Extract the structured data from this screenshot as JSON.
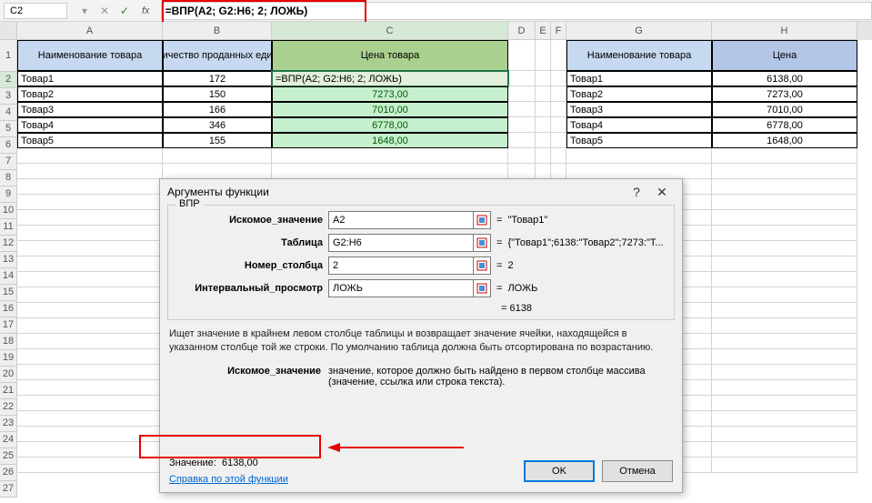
{
  "formula_bar": {
    "cell_ref": "C2",
    "formula": "=ВПР(A2; G2:H6; 2; ЛОЖЬ)"
  },
  "columns": [
    "A",
    "B",
    "C",
    "D",
    "E",
    "F",
    "G",
    "H"
  ],
  "row_numbers": [
    1,
    2,
    3,
    4,
    5,
    6,
    7,
    8,
    9,
    10,
    11,
    12,
    13,
    14,
    15,
    16,
    17,
    18,
    19,
    20,
    21,
    22,
    23,
    24,
    25,
    26,
    27
  ],
  "headers": {
    "A": "Наименование товара",
    "B": "Количество проданных единиц",
    "C": "Цена товара",
    "G": "Наименование товара",
    "H": "Цена"
  },
  "table1": [
    {
      "name": "Товар1",
      "qty": "172",
      "price": "=ВПР(A2; G2:H6; 2; ЛОЖЬ)"
    },
    {
      "name": "Товар2",
      "qty": "150",
      "price": "7273,00"
    },
    {
      "name": "Товар3",
      "qty": "166",
      "price": "7010,00"
    },
    {
      "name": "Товар4",
      "qty": "346",
      "price": "6778,00"
    },
    {
      "name": "Товар5",
      "qty": "155",
      "price": "1648,00"
    }
  ],
  "table2": [
    {
      "name": "Товар1",
      "price": "6138,00"
    },
    {
      "name": "Товар2",
      "price": "7273,00"
    },
    {
      "name": "Товар3",
      "price": "7010,00"
    },
    {
      "name": "Товар4",
      "price": "6778,00"
    },
    {
      "name": "Товар5",
      "price": "1648,00"
    }
  ],
  "dialog": {
    "title": "Аргументы функции",
    "func_name": "ВПР",
    "args": [
      {
        "label": "Искомое_значение",
        "value": "A2",
        "result": "\"Товар1\""
      },
      {
        "label": "Таблица",
        "value": "G2:H6",
        "result": "{\"Товар1\";6138:\"Товар2\";7273:\"Т..."
      },
      {
        "label": "Номер_столбца",
        "value": "2",
        "result": "2"
      },
      {
        "label": "Интервальный_просмотр",
        "value": "ЛОЖЬ",
        "result": "ЛОЖЬ"
      }
    ],
    "overall_result": "6138",
    "description": "Ищет значение в крайнем левом столбце таблицы и возвращает значение ячейки, находящейся в указанном столбце той же строки. По умолчанию таблица должна быть отсортирована по возрастанию.",
    "arg_name": "Искомое_значение",
    "arg_desc": "значение, которое должно быть найдено в первом столбце массива (значение, ссылка или строка текста).",
    "value_label": "Значение:",
    "value": "6138,00",
    "help_link": "Справка по этой функции",
    "ok": "OK",
    "cancel": "Отмена"
  }
}
